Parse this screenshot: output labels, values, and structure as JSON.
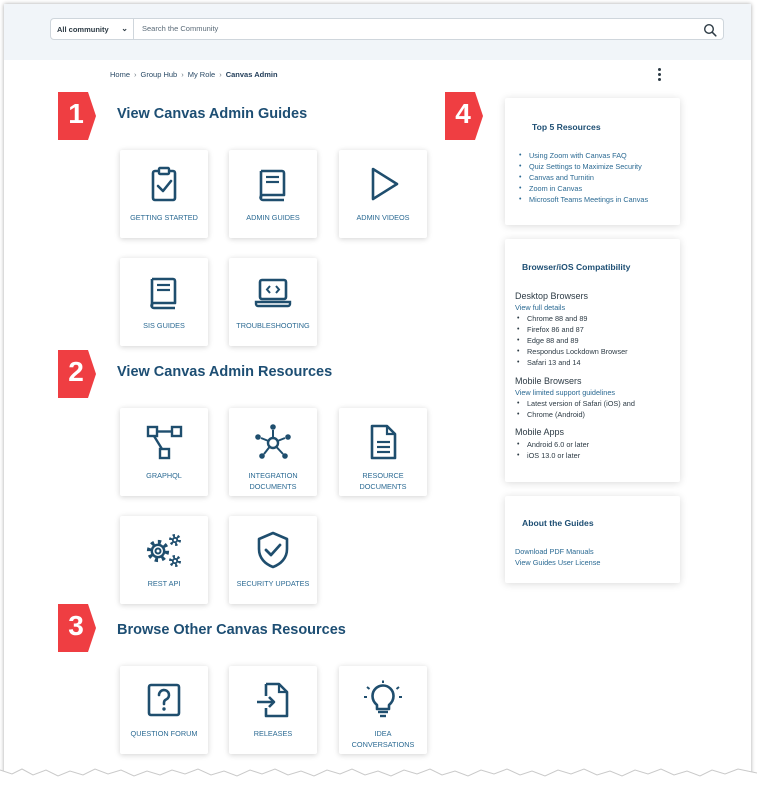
{
  "search": {
    "scope_label": "All community",
    "placeholder": "Search the Community"
  },
  "breadcrumb": {
    "items": [
      "Home",
      "Group Hub",
      "My Role"
    ],
    "current": "Canvas Admin"
  },
  "sections": [
    {
      "number": "1",
      "title": "View Canvas Admin Guides",
      "cards": [
        {
          "label": "GETTING STARTED",
          "icon": "clipboard-check-icon"
        },
        {
          "label": "ADMIN GUIDES",
          "icon": "book-icon"
        },
        {
          "label": "ADMIN VIDEOS",
          "icon": "play-icon"
        },
        {
          "label": "SIS GUIDES",
          "icon": "book-icon"
        },
        {
          "label": "TROUBLESHOOTING",
          "icon": "laptop-code-icon"
        }
      ]
    },
    {
      "number": "2",
      "title": "View Canvas Admin Resources",
      "cards": [
        {
          "label": "GRAPHQL",
          "icon": "graph-icon"
        },
        {
          "label": "INTEGRATION DOCUMENTS",
          "label_lines": [
            "INTEGRATION",
            "DOCUMENTS"
          ],
          "icon": "network-icon"
        },
        {
          "label": "RESOURCE DOCUMENTS",
          "label_lines": [
            "RESOURCE",
            "DOCUMENTS"
          ],
          "icon": "document-icon"
        },
        {
          "label": "REST API",
          "icon": "gears-icon"
        },
        {
          "label": "SECURITY UPDATES",
          "icon": "shield-check-icon"
        }
      ]
    },
    {
      "number": "3",
      "title": "Browse Other Canvas Resources",
      "cards": [
        {
          "label": "QUESTION FORUM",
          "icon": "question-icon"
        },
        {
          "label": "RELEASES",
          "icon": "file-import-icon"
        },
        {
          "label": "IDEA CONVERSATIONS",
          "label_lines": [
            "IDEA",
            "CONVERSATIONS"
          ],
          "icon": "lightbulb-icon"
        }
      ]
    }
  ],
  "sidebar": {
    "badge": "4",
    "top5": {
      "title": "Top 5 Resources",
      "items": [
        "Using Zoom with Canvas FAQ",
        "Quiz Settings to Maximize Security",
        "Canvas and Turnitin",
        "Zoom in Canvas",
        "Microsoft Teams Meetings in Canvas"
      ]
    },
    "compat": {
      "title": "Browser/iOS Compatibility",
      "desktop": {
        "heading": "Desktop Browsers",
        "link": "View full details",
        "items": [
          "Chrome 88 and 89",
          "Firefox 86 and 87",
          "Edge 88 and 89",
          "Respondus Lockdown Browser",
          "Safari 13 and 14"
        ]
      },
      "mobile": {
        "heading": "Mobile Browsers",
        "link": "View limited support guidelines",
        "items": [
          "Latest version of Safari (iOS) and",
          "Chrome (Android)"
        ]
      },
      "apps": {
        "heading": "Mobile Apps",
        "items": [
          "Android 6.0 or later",
          "iOS 13.0 or later"
        ]
      }
    },
    "about": {
      "title": "About the Guides",
      "links": [
        "Download PDF Manuals",
        "View Guides User License"
      ]
    }
  },
  "colors": {
    "badge_red": "#ef3e42",
    "title_blue": "#1d4e73",
    "link_blue": "#2b6a93",
    "icon_blue": "#1f4e6e"
  }
}
